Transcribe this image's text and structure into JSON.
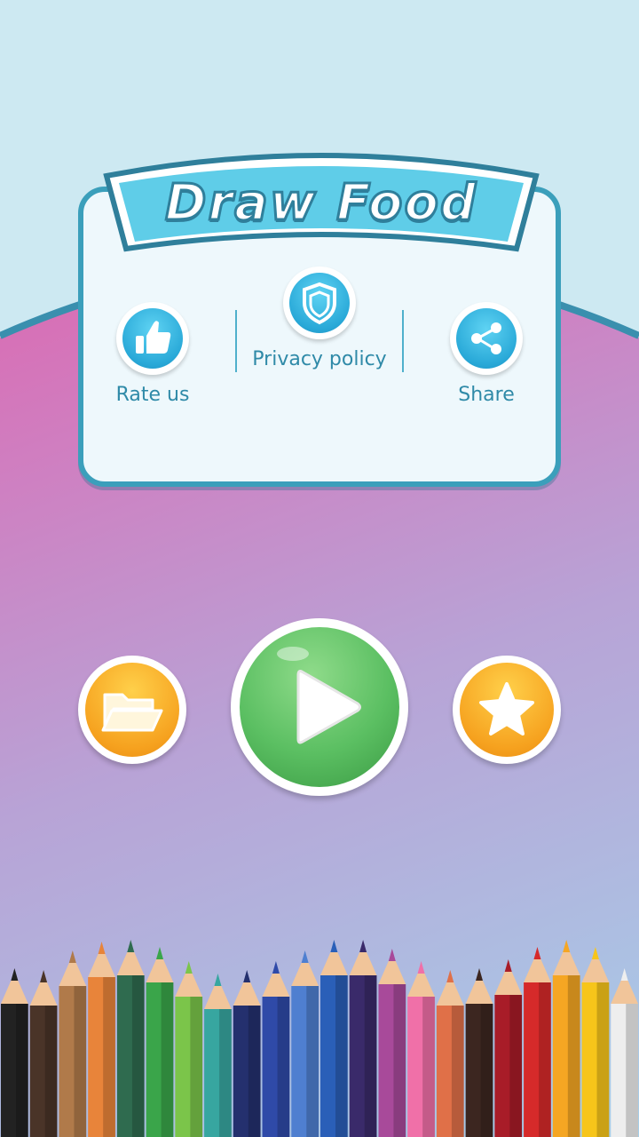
{
  "app": {
    "title": "Draw Food"
  },
  "menu": {
    "rate_label": "Rate us",
    "privacy_label": "Privacy policy",
    "share_label": "Share"
  },
  "colors": {
    "play_green": "#4cb25c",
    "orange": "#f5a623",
    "accent_blue": "#29a9d8",
    "frame_teal": "#3b9fbb"
  },
  "icons": [
    "thumbs-up-icon",
    "shield-icon",
    "share-icon",
    "folder-icon",
    "play-icon",
    "star-icon"
  ]
}
